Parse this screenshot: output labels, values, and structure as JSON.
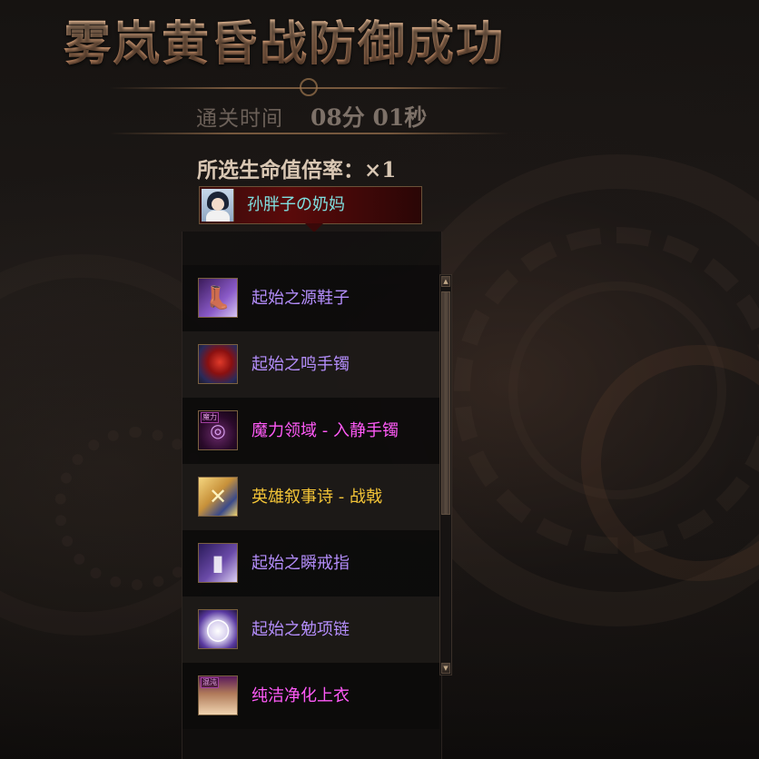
{
  "header": {
    "title": "雾岚黄昏战防御成功"
  },
  "clear_time": {
    "label": "通关时间",
    "value": "08分 01秒"
  },
  "hp_rate": {
    "text": "所选生命值倍率：×1"
  },
  "player": {
    "name": "孙胖子の奶妈",
    "name_color": "#7fe0e0"
  },
  "rewards": {
    "items": [
      {
        "name": "起始之源鞋子",
        "rarity": "unique",
        "color": "#b38dfa",
        "icon": "shoes-icon"
      },
      {
        "name": "起始之鸣手镯",
        "rarity": "unique",
        "color": "#b38dfa",
        "icon": "bracelet-icon"
      },
      {
        "name": "魔力领域 - 入静手镯",
        "rarity": "epic",
        "color": "#ff5af7",
        "icon": "magic-bracelet-icon",
        "icon_tag": "魔力"
      },
      {
        "name": "英雄叙事诗 - 战戟",
        "rarity": "legendary",
        "color": "#f3c437",
        "icon": "halberd-icon"
      },
      {
        "name": "起始之瞬戒指",
        "rarity": "unique",
        "color": "#b38dfa",
        "icon": "ring-icon"
      },
      {
        "name": "起始之勉项链",
        "rarity": "unique",
        "color": "#b38dfa",
        "icon": "necklace-icon"
      },
      {
        "name": "纯洁净化上衣",
        "rarity": "epic",
        "color": "#ff5af7",
        "icon": "top-icon",
        "icon_tag": "混沌"
      }
    ]
  },
  "theme": {
    "title_color": "#e7b58c",
    "panel_bg": "#12100f"
  }
}
